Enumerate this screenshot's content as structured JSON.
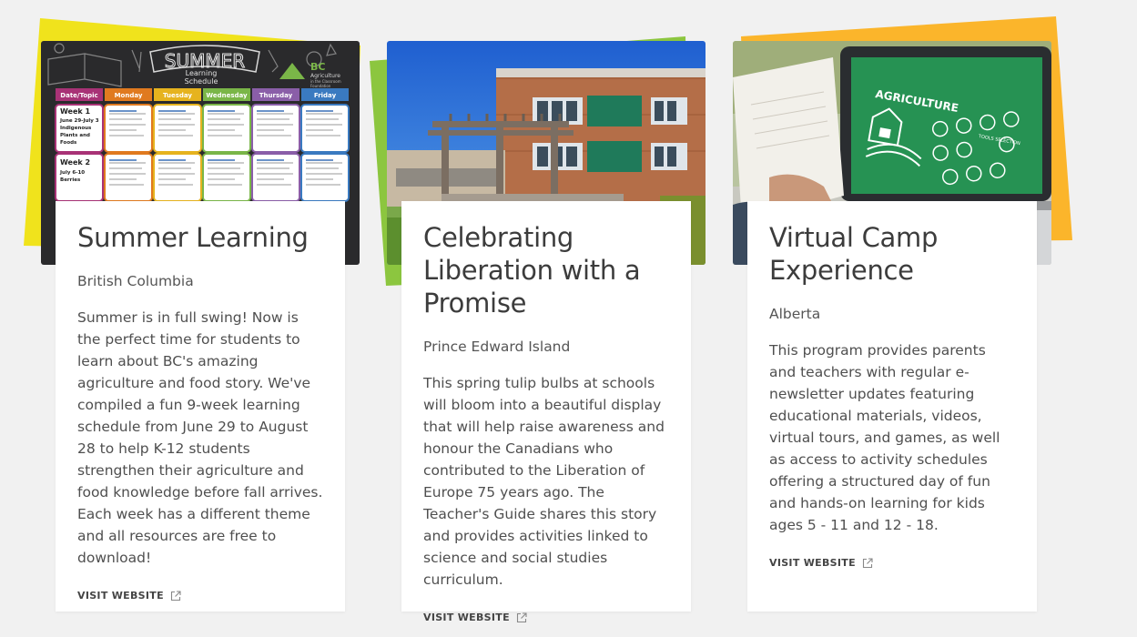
{
  "cards": [
    {
      "title": "Summer Learning",
      "region": "British Columbia",
      "description": "Summer is in full swing! Now is the perfect time for students to learn about BC's amazing agriculture and food story. We've compiled a fun 9-week learning schedule from June 29 to August 28 to help K-12 students strengthen their agriculture and food knowledge before fall arrives. Each week has a different theme and all resources are free to download!",
      "link_label": "VISIT WEBSITE",
      "accent_color": "#f0e31c",
      "image": {
        "banner": "SUMMER",
        "subtitle_1": "Learning",
        "subtitle_2": "Schedule",
        "logo_text": "BC",
        "logo_sub": "Agriculture",
        "logo_sub2": "in the Classroom",
        "logo_sub3": "Foundation",
        "headers": [
          "Date/Topic",
          "Monday",
          "Tuesday",
          "Wednesday",
          "Thursday",
          "Friday"
        ],
        "week1_title": "Week 1",
        "week1_sub1": "June 29-July 3",
        "week1_sub2": "Indigenous",
        "week1_sub3": "Plants and",
        "week1_sub4": "Foods",
        "week2_title": "Week 2",
        "week2_sub1": "July 6-10",
        "week2_sub2": "Berries"
      }
    },
    {
      "title": "Celebrating Liberation with a Promise",
      "region": "Prince Edward Island",
      "description": "This spring tulip bulbs at schools will bloom into a beautiful display that will help raise awareness and honour the Canadians who contributed to the Liberation of Europe 75 years ago. The Teacher's Guide shares this story and provides activities linked to science and social studies curriculum.",
      "link_label": "VISIT WEBSITE",
      "accent_color": "#8cc63f"
    },
    {
      "title": "Virtual Camp Experience",
      "region": "Alberta",
      "description": "This program provides parents and teachers with regular e-newsletter updates featuring educational materials, videos, virtual tours, and games, as well as access to activity schedules offering a structured day of fun and hands-on learning for kids ages 5 - 11 and 12 - 18.",
      "link_label": "VISIT WEBSITE",
      "accent_color": "#fbb52b",
      "image": {
        "screen_title": "AGRICULTURE",
        "screen_label": "TOOLS SELECTION"
      }
    }
  ],
  "colors": {
    "background": "#f1f1f1",
    "card": "#ffffff",
    "title_text": "#3c3c3c",
    "body_text": "#4f4f4f"
  },
  "icons": {
    "external_link": "external-link-icon"
  }
}
